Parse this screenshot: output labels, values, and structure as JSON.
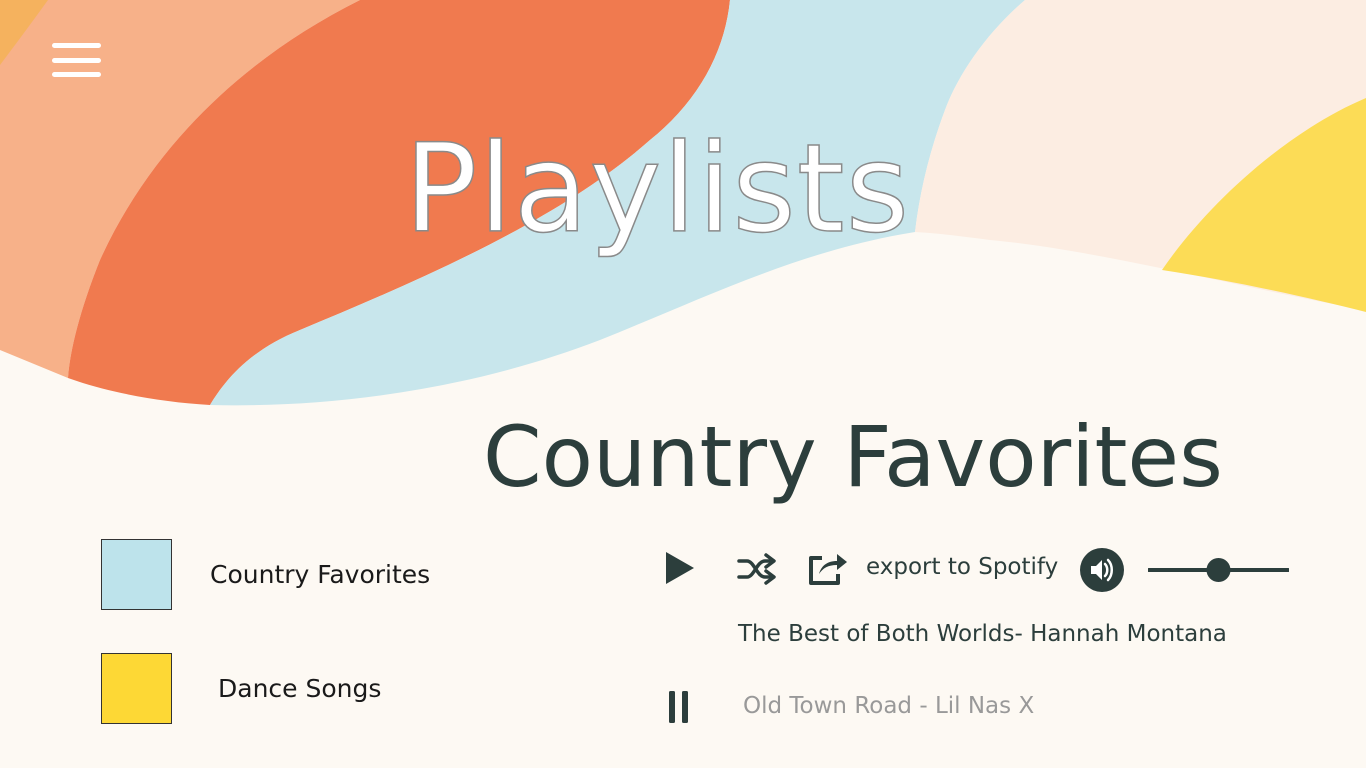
{
  "colors": {
    "background": "#fdf9f3",
    "peach": "#f7b189",
    "orange": "#f07a4f",
    "light_blue": "#c8e6ec",
    "cream": "#fcede2",
    "yellow": "#fcdc56",
    "dark_teal": "#2c3e3c",
    "swatch_blue": "#bde3eb",
    "swatch_yellow": "#fdd835"
  },
  "header": {
    "menu_icon": "hamburger-menu-icon",
    "title": "Playlists"
  },
  "main": {
    "playlist_title": "Country Favorites"
  },
  "playlists": [
    {
      "label": "Country Favorites",
      "color": "#bde3eb"
    },
    {
      "label": "Dance Songs",
      "color": "#fdd835"
    }
  ],
  "player": {
    "play_icon": "play-icon",
    "shuffle_icon": "shuffle-icon",
    "export_icon": "share-export-icon",
    "export_label": "export to Spotify",
    "volume_icon": "speaker-icon",
    "volume_level": 0.5,
    "now_playing": "The Best of Both Worlds- Hannah Montana",
    "pause_icon": "pause-icon",
    "up_next": "Old Town Road - Lil Nas X"
  }
}
